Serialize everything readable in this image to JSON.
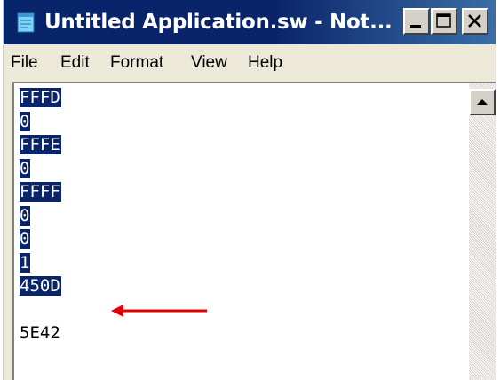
{
  "window": {
    "title": "Untitled Application.sw - Not...",
    "icon": "notepad-icon",
    "controls": [
      "minimize-icon",
      "maximize-icon",
      "close-icon"
    ]
  },
  "menu": {
    "items": [
      "File",
      "Edit",
      "Format",
      "View",
      "Help"
    ]
  },
  "editor": {
    "lines": [
      {
        "text": "FFFD",
        "selected": true
      },
      {
        "text": "0",
        "selected": true
      },
      {
        "text": "FFFE",
        "selected": true
      },
      {
        "text": "0",
        "selected": true
      },
      {
        "text": "FFFF",
        "selected": true
      },
      {
        "text": "0",
        "selected": true
      },
      {
        "text": "0",
        "selected": true
      },
      {
        "text": "1",
        "selected": true
      },
      {
        "text": "450D",
        "selected": true
      },
      {
        "text": "",
        "selected": false
      },
      {
        "text": "5E42",
        "selected": false
      }
    ]
  },
  "annotation": {
    "arrow_color": "#e00000"
  },
  "colors": {
    "selection": "#0a246a",
    "titlebar": "#0a246a"
  }
}
